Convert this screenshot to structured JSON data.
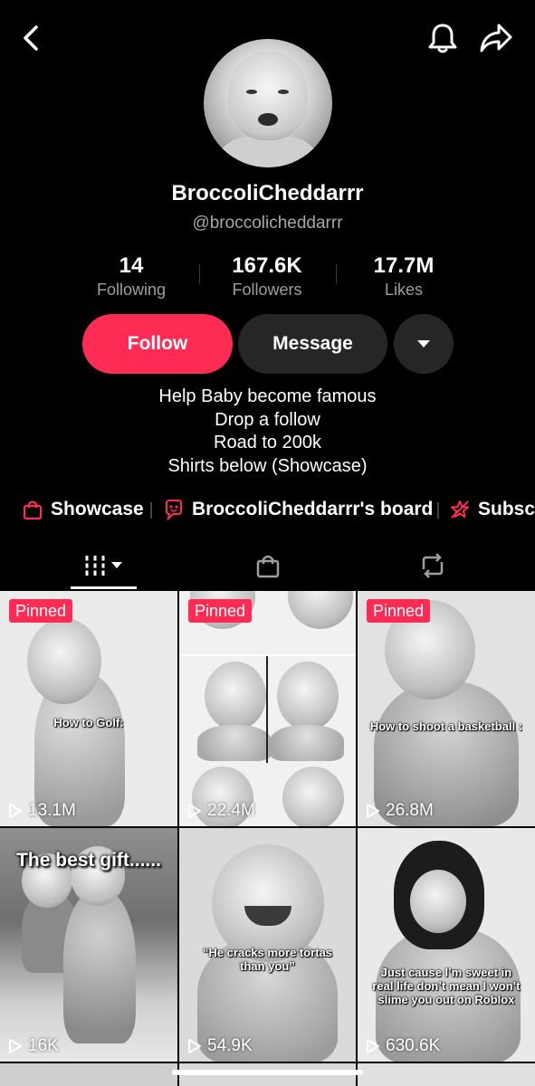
{
  "profile": {
    "display_name": "BroccoliCheddarrr",
    "handle": "@broccolicheddarrr",
    "stats": [
      {
        "value": "14",
        "label": "Following"
      },
      {
        "value": "167.6K",
        "label": "Followers"
      },
      {
        "value": "17.7M",
        "label": "Likes"
      }
    ],
    "bio": [
      "Help Baby become famous",
      "Drop a follow",
      "Road to 200k",
      "Shirts below (Showcase)"
    ]
  },
  "actions": {
    "follow_label": "Follow",
    "message_label": "Message"
  },
  "links": [
    {
      "label": "Showcase",
      "icon": "shopping-bag-icon"
    },
    {
      "label": "BroccoliCheddarrr's board",
      "icon": "board-icon"
    },
    {
      "label": "Subscr",
      "icon": "subscription-icon"
    }
  ],
  "tabs": [
    {
      "icon": "videos-grid-icon",
      "active": true
    },
    {
      "icon": "shop-bag-icon",
      "active": false
    },
    {
      "icon": "repost-icon",
      "active": false
    }
  ],
  "videos": [
    {
      "pinned": "Pinned",
      "caption": "How to Golf:",
      "views": "13.1M"
    },
    {
      "pinned": "Pinned",
      "caption": "",
      "views": "22.4M"
    },
    {
      "pinned": "Pinned",
      "caption": "How to shoot a basketball :",
      "views": "26.8M"
    },
    {
      "pinned": "",
      "caption": "The best gift......",
      "views": "16K"
    },
    {
      "pinned": "",
      "caption": "“He cracks more tortas than you”",
      "views": "54.9K"
    },
    {
      "pinned": "",
      "caption": "Just cause I’m sweet in real life don’t mean I won’t slime you out on Roblox",
      "views": "630.6K"
    }
  ],
  "colors": {
    "accent": "#fe2c55",
    "background": "#000000",
    "secondary_button": "#262626"
  }
}
